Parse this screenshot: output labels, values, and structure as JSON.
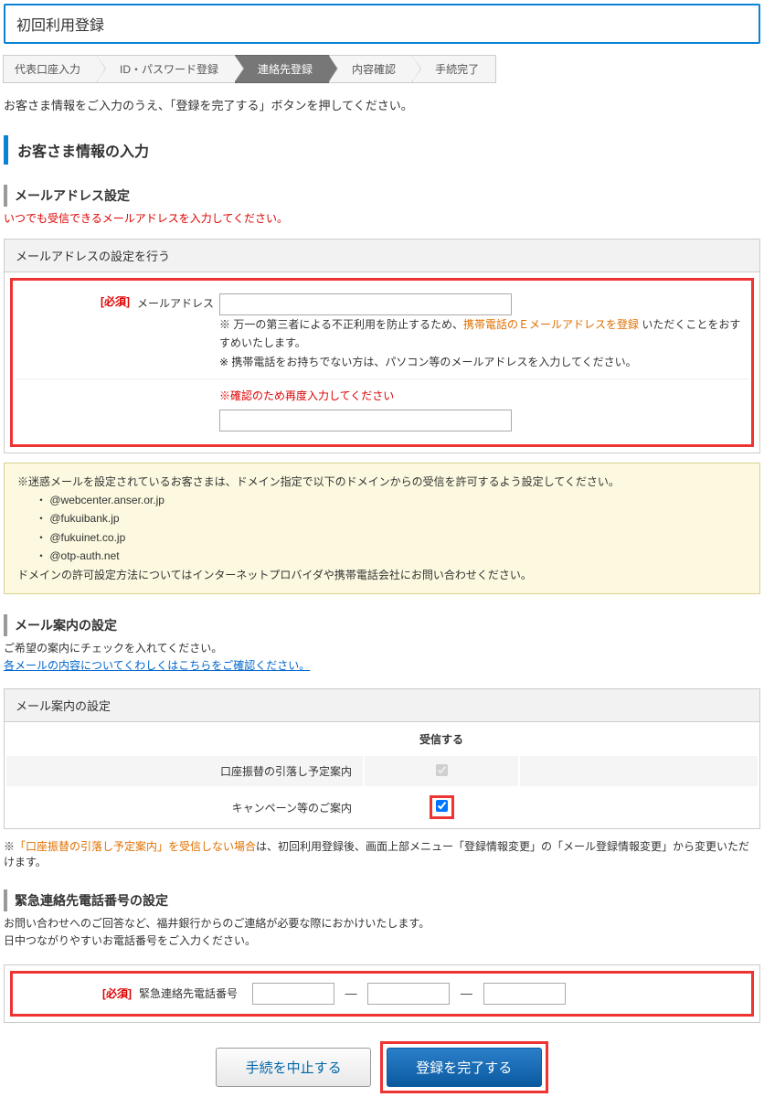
{
  "pageTitle": "初回利用登録",
  "steps": [
    {
      "label": "代表口座入力",
      "active": false
    },
    {
      "label": "ID・パスワード登録",
      "active": false
    },
    {
      "label": "連絡先登録",
      "active": true
    },
    {
      "label": "内容確認",
      "active": false
    },
    {
      "label": "手続完了",
      "active": false
    }
  ],
  "intro": "お客さま情報をご入力のうえ、「登録を完了する」ボタンを押してください。",
  "customerInfoHeading": "お客さま情報の入力",
  "email": {
    "heading": "メールアドレス設定",
    "note": "いつでも受信できるメールアドレスを入力してください。",
    "panelTitle": "メールアドレスの設定を行う",
    "required": "[必須]",
    "label": "メールアドレス",
    "desc1Prefix": "※ 万一の第三者による不正利用を防止するため、",
    "desc1Highlight": "携帯電話のＥメールアドレスを登録",
    "desc1Suffix": " いただくことをおすすめいたします。",
    "desc2": "※ 携帯電話をお持ちでない方は、パソコン等のメールアドレスを入力してください。",
    "confirmNote": "※確認のため再度入力してください"
  },
  "spamInfo": {
    "lead": "※迷惑メールを設定されているお客さまは、ドメイン指定で以下のドメインからの受信を許可するよう設定してください。",
    "domains": [
      "@webcenter.anser.or.jp",
      "@fukuibank.jp",
      "@fukuinet.co.jp",
      "@otp-auth.net"
    ],
    "tail": "ドメインの許可設定方法についてはインターネットプロバイダや携帯電話会社にお問い合わせください。"
  },
  "guide": {
    "heading": "メール案内の設定",
    "desc": "ご希望の案内にチェックを入れてください。",
    "link": "各メールの内容についてくわしくはこちらをご確認ください。",
    "panelTitle": "メール案内の設定",
    "header": "受信する",
    "rows": [
      {
        "label": "口座振替の引落し予定案内",
        "checked": true,
        "disabled": true,
        "highlight": false
      },
      {
        "label": "キャンペーン等のご案内",
        "checked": true,
        "disabled": false,
        "highlight": true
      }
    ],
    "warnPrefix": "※",
    "warnHighlight": "「口座振替の引落し予定案内」を受信しない場合",
    "warnSuffix": "は、初回利用登録後、画面上部メニュー「登録情報変更」の「メール登録情報変更」から変更いただけます。"
  },
  "phone": {
    "heading": "緊急連絡先電話番号の設定",
    "desc1": "お問い合わせへのご回答など、福井銀行からのご連絡が必要な際におかけいたします。",
    "desc2": "日中つながりやすいお電話番号をご入力ください。",
    "required": "[必須]",
    "label": "緊急連絡先電話番号",
    "sep": "—"
  },
  "buttons": {
    "cancel": "手続を中止する",
    "submit": "登録を完了する"
  }
}
